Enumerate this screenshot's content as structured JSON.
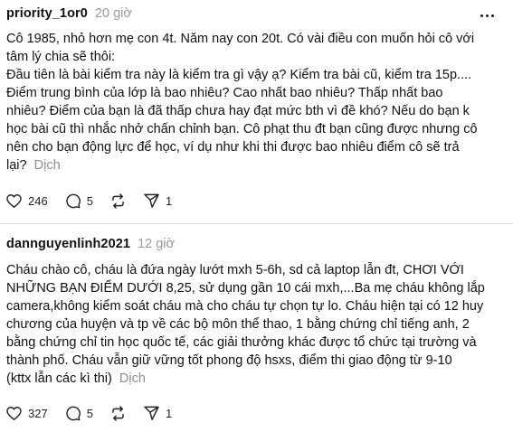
{
  "posts": [
    {
      "username": "priority_1or0",
      "time": "20 giờ",
      "lines": [
        "Cô 1985, nhỏ hơn mẹ con 4t. Năm nay con 20t. Có vài điều con muốn hỏi cô với",
        "tâm lý chia sẽ thôi:",
        "Đầu tiên là bài kiểm tra này là kiểm tra gì vậy ạ? Kiểm tra bài cũ, kiểm tra 15p....",
        "Điểm trung bình của lớp là bao nhiêu? Cao nhất bao nhiêu? Thấp nhất bao",
        "nhiêu? Điểm của bạn là đã thấp chưa hay đạt mức bth vì đề khó? Nếu do bạn k",
        "học bài cũ thì nhắc nhở chấn chỉnh bạn. Cô phạt thu đt bạn cũng được nhưng cô",
        "nên cho bạn động lực để học, ví dụ như khi thi được bao nhiêu điểm cô sẽ trả"
      ],
      "last_line": "lại?",
      "translate_label": "Dịch",
      "likes": "246",
      "comments": "5",
      "shares": "1"
    },
    {
      "username": "dannguyenlinh2021",
      "time": "12 giờ",
      "lines": [
        "Cháu chào cô, cháu là đứa ngày lướt mxh 5-6h, sd cả laptop lẫn đt, CHƠI VỚI",
        "NHỮNG BẠN ĐIỂM DƯỚI 8,25, sử dụng gần 10 cái mxh,...Ba mẹ cháu không lắp",
        "camera,không kiểm soát cháu mà cho cháu tự chọn tự lo. Cháu hiện tại có 12 huy",
        "chương của huyện và tp về các bộ môn thể thao, 1 bằng chứng chỉ tiếng anh, 2",
        "bằng chứng chỉ tin học quốc tế, các giải thưởng khác được tổ chức tại trường và",
        "thành phố. Cháu vẫn giữ vững tốt phong độ hsxs, điểm thi giao động từ 9-10"
      ],
      "last_line": "(kttx lẫn các kì thi)",
      "translate_label": "Dịch",
      "likes": "327",
      "comments": "5",
      "shares": "1"
    }
  ],
  "icons": {
    "more": "more-options-icon",
    "like": "heart-icon",
    "comment": "comment-icon",
    "repost": "repost-icon",
    "share": "send-icon"
  }
}
